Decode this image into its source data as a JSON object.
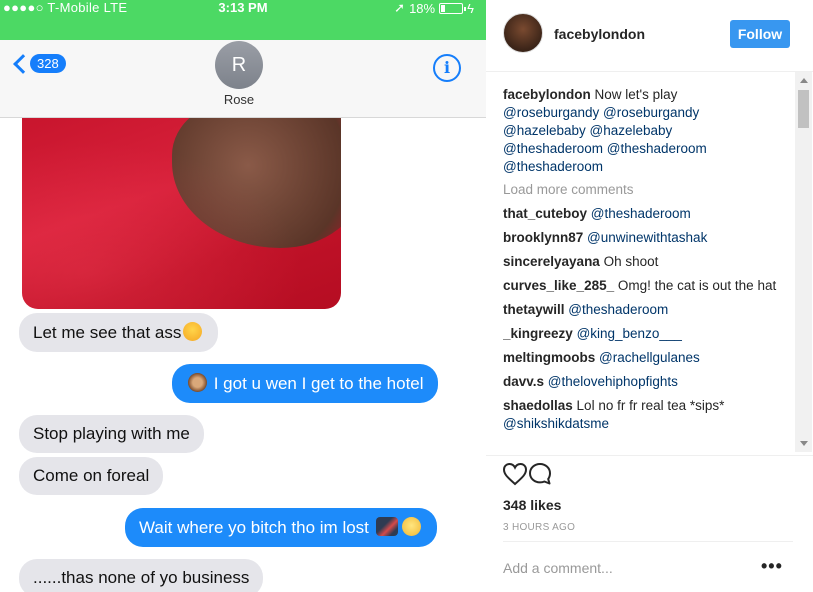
{
  "phone": {
    "status": {
      "carrier": "●●●●○ T-Mobile  LTE",
      "time": "3:13 PM",
      "battery_text": "18%",
      "battery_level": 0.18
    },
    "nav": {
      "back_count": "328",
      "contact_initial": "R",
      "contact_name": "Rose"
    },
    "messages": [
      {
        "from": "them",
        "text": "Let me see that ass",
        "emoji": "winking-face"
      },
      {
        "from": "me",
        "text": " I got u wen I get to the hotel",
        "emoji": "see-no-evil-monkey"
      },
      {
        "from": "them",
        "text": "Stop playing with me"
      },
      {
        "from": "them",
        "text": "Come on foreal"
      },
      {
        "from": "me",
        "text": "Wait where yo bitch tho im lost ",
        "emoji": "ninja-rolling-eyes"
      },
      {
        "from": "them",
        "text": "......thas none of yo business"
      }
    ]
  },
  "instagram": {
    "username": "facebylondon",
    "follow_label": "Follow",
    "caption": {
      "user": "facebylondon",
      "text": "Now let's play",
      "mentions": [
        "@roseburgandy",
        "@roseburgandy",
        "@hazelebaby",
        "@hazelebaby",
        "@theshaderoom",
        "@theshaderoom",
        "@theshaderoom"
      ]
    },
    "load_more": "Load more comments",
    "comments": [
      {
        "user": "that_cuteboy",
        "text": "",
        "mention": "@theshaderoom"
      },
      {
        "user": "brooklynn87",
        "text": "",
        "mention": "@unwinewithtashak"
      },
      {
        "user": "sincerelyayana",
        "text": "Oh shoot",
        "mention": ""
      },
      {
        "user": "curves_like_285_",
        "text": "Omg!  the cat is out the hat",
        "mention": ""
      },
      {
        "user": "thetaywill",
        "text": "",
        "mention": "@theshaderoom"
      },
      {
        "user": "_kingreezy",
        "text": "",
        "mention": "@king_benzo___"
      },
      {
        "user": "meltingmoobs",
        "text": "",
        "mention": "@rachellgulanes"
      },
      {
        "user": "davv.s",
        "text": "",
        "mention": "@thelovehiphopfights"
      },
      {
        "user": "shaedollas",
        "text": "Lol no fr fr real  tea *sips*",
        "mention": "@shikshikdatsme"
      }
    ],
    "likes": "348 likes",
    "time_ago": "3 HOURS AGO",
    "add_comment_placeholder": "Add a comment...",
    "more_label": "•••",
    "icons": [
      "heart-icon",
      "comment-icon",
      "more-options-icon"
    ]
  }
}
